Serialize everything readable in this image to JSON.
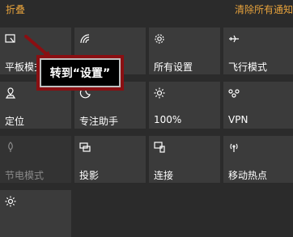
{
  "header": {
    "collapse_label": "折叠",
    "clear_all_label": "清除所有通知"
  },
  "tiles": [
    {
      "label": "平板模式",
      "icon": "tablet-mode-icon",
      "state": "on"
    },
    {
      "label": "",
      "icon": "network-icon",
      "state": "on"
    },
    {
      "label": "所有设置",
      "icon": "gear-icon",
      "state": "on"
    },
    {
      "label": "飞行模式",
      "icon": "airplane-icon",
      "state": "on"
    },
    {
      "label": "定位",
      "icon": "location-icon",
      "state": "on"
    },
    {
      "label": "专注助手",
      "icon": "moon-icon",
      "state": "on"
    },
    {
      "label": "100%",
      "icon": "brightness-icon",
      "state": "on"
    },
    {
      "label": "VPN",
      "icon": "vpn-icon",
      "state": "on"
    },
    {
      "label": "节电模式",
      "icon": "battery-saver-icon",
      "state": "off"
    },
    {
      "label": "投影",
      "icon": "project-icon",
      "state": "on"
    },
    {
      "label": "连接",
      "icon": "connect-icon",
      "state": "on"
    },
    {
      "label": "移动热点",
      "icon": "hotspot-icon",
      "state": "on"
    },
    {
      "label": "",
      "icon": "night-light-icon",
      "state": "on"
    }
  ],
  "callout": {
    "text": "转到“设置”"
  },
  "colors": {
    "accent": "#e6a23c",
    "callout_border": "#8a0f12",
    "tile": "#3b3b3b",
    "background": "#2b2b2b"
  }
}
